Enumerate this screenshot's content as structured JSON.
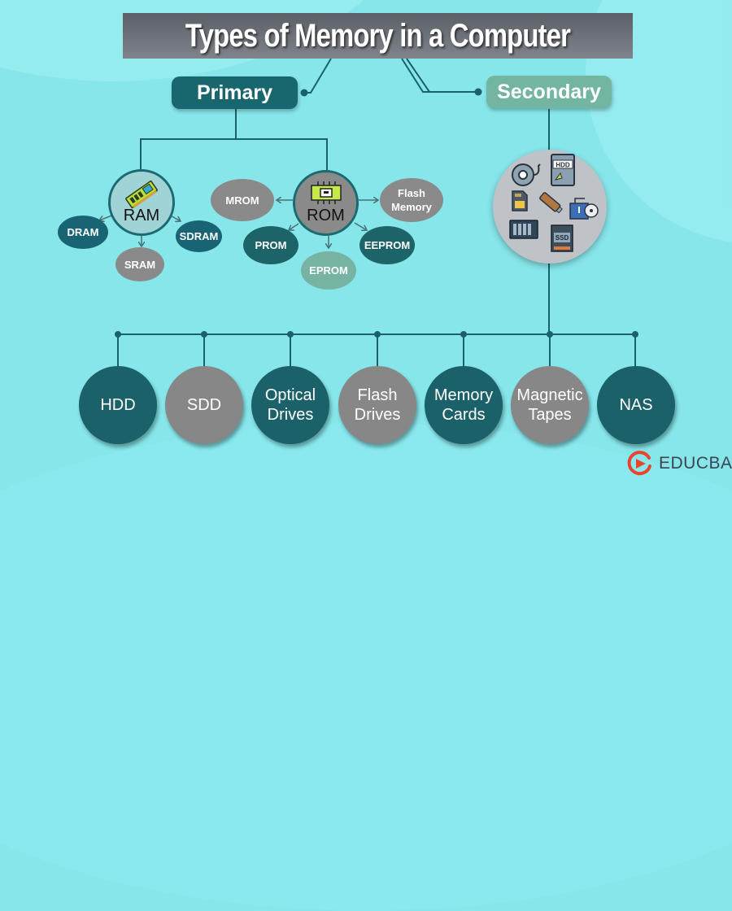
{
  "title": "Types of Memory in a Computer",
  "branches": {
    "primary": {
      "label": "Primary",
      "ram": {
        "label": "RAM",
        "icon": "ram-chip-icon",
        "children": [
          "DRAM",
          "SRAM",
          "SDRAM"
        ]
      },
      "rom": {
        "label": "ROM",
        "icon": "rom-chip-icon",
        "children": [
          "MROM",
          "PROM",
          "EPROM",
          "EEPROM",
          "Flash Memory"
        ]
      }
    },
    "secondary": {
      "label": "Secondary",
      "icons": [
        "tape-reel-icon",
        "hdd-icon",
        "memory-card-icon",
        "usb-drive-icon",
        "optical-drive-icon",
        "nas-icon",
        "ssd-icon"
      ],
      "hdd_icon_text": "HDD",
      "ssd_icon_text": "SSD",
      "children": [
        {
          "line1": "HDD",
          "line2": ""
        },
        {
          "line1": "SDD",
          "line2": ""
        },
        {
          "line1": "Optical",
          "line2": "Drives"
        },
        {
          "line1": "Flash",
          "line2": "Drives"
        },
        {
          "line1": "Memory",
          "line2": "Cards"
        },
        {
          "line1": "Magnetic",
          "line2": "Tapes"
        },
        {
          "line1": "NAS",
          "line2": ""
        }
      ]
    }
  },
  "brand": {
    "name": "EDUCBA",
    "icon": "educba-logo-icon"
  },
  "colors": {
    "background": "#86e6ea",
    "dark_teal": "#1b6169",
    "grey": "#878787",
    "sage": "#72b5a1",
    "title_bar": "#6a6e75",
    "brand_red": "#e8452c"
  }
}
